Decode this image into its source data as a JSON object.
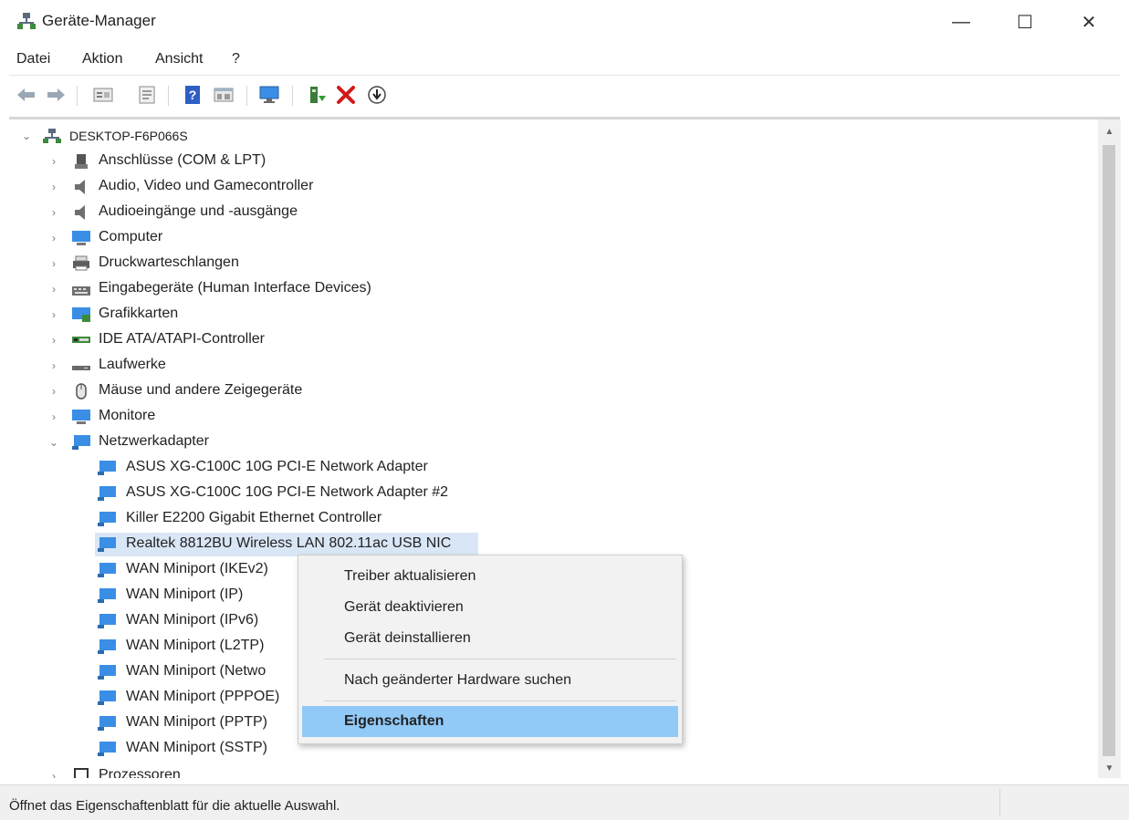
{
  "window": {
    "title": "Geräte-Manager",
    "minimize_glyph": "—",
    "maximize_glyph": "☐",
    "close_glyph": "✕"
  },
  "menu": [
    "Datei",
    "Aktion",
    "Ansicht",
    "?"
  ],
  "toolbar": {
    "icons": [
      "back-arrow-icon",
      "forward-arrow-icon",
      "device-list-icon",
      "properties-sheet-icon",
      "help-icon",
      "show-hide-icon",
      "monitor-scan-icon",
      "update-driver-icon",
      "uninstall-icon",
      "download-icon"
    ]
  },
  "tree": {
    "root": "DESKTOP-F6P066S",
    "categories": [
      {
        "label": "Anschlüsse (COM & LPT)",
        "icon": "port-icon"
      },
      {
        "label": "Audio, Video und Gamecontroller",
        "icon": "speaker-icon"
      },
      {
        "label": "Audioeingänge und -ausgänge",
        "icon": "speaker-icon"
      },
      {
        "label": "Computer",
        "icon": "computer-icon"
      },
      {
        "label": "Druckwarteschlangen",
        "icon": "printer-icon"
      },
      {
        "label": "Eingabegeräte (Human Interface Devices)",
        "icon": "hid-icon"
      },
      {
        "label": "Grafikkarten",
        "icon": "display-adapter-icon"
      },
      {
        "label": "IDE ATA/ATAPI-Controller",
        "icon": "ide-controller-icon"
      },
      {
        "label": "Laufwerke",
        "icon": "disk-drive-icon"
      },
      {
        "label": "Mäuse und andere Zeigegeräte",
        "icon": "mouse-icon"
      },
      {
        "label": "Monitore",
        "icon": "monitor-icon"
      }
    ],
    "expanded_category": "Netzwerkadapter",
    "network_adapters": [
      "ASUS XG-C100C 10G PCI-E Network Adapter",
      "ASUS XG-C100C 10G PCI-E Network Adapter #2",
      "Killer E2200 Gigabit Ethernet Controller",
      "Realtek 8812BU Wireless LAN 802.11ac USB NIC",
      "WAN Miniport (IKEv2)",
      "WAN Miniport (IP)",
      "WAN Miniport (IPv6)",
      "WAN Miniport (L2TP)",
      "WAN Miniport (Netwo",
      "WAN Miniport (PPPOE)",
      "WAN Miniport (PPTP)",
      "WAN Miniport (SSTP)"
    ],
    "selected_adapter": "Realtek 8812BU Wireless LAN 802.11ac USB NIC",
    "partial_last_row": "Prozessoren"
  },
  "context_menu": {
    "items": [
      "Treiber aktualisieren",
      "Gerät deaktivieren",
      "Gerät deinstallieren",
      "Nach geänderter Hardware suchen",
      "Eigenschaften"
    ],
    "highlighted": "Eigenschaften"
  },
  "status_bar": "Öffnet das Eigenschaftenblatt für die aktuelle Auswahl.",
  "colors": {
    "selection": "#d9e6f5",
    "menu_highlight": "#91c9f7",
    "uninstall_red": "#d11a1a",
    "network_blue": "#2b88d8"
  }
}
